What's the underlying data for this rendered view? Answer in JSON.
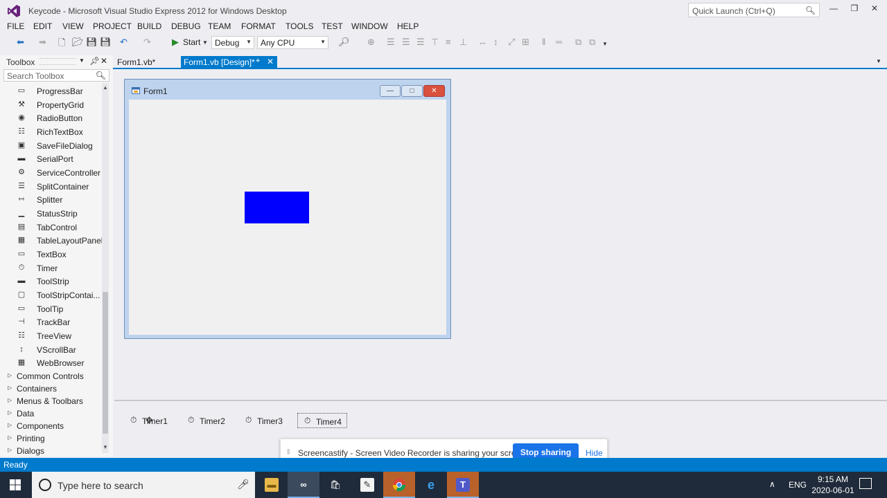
{
  "window": {
    "title": "Keycode - Microsoft Visual Studio Express 2012 for Windows Desktop",
    "quick_launch_placeholder": "Quick Launch (Ctrl+Q)"
  },
  "menu": [
    "FILE",
    "EDIT",
    "VIEW",
    "PROJECT",
    "BUILD",
    "DEBUG",
    "TEAM",
    "FORMAT",
    "TOOLS",
    "TEST",
    "WINDOW",
    "HELP"
  ],
  "toolbar": {
    "start_label": "Start",
    "config_value": "Debug",
    "platform_value": "Any CPU"
  },
  "toolbox": {
    "title": "Toolbox",
    "search_placeholder": "Search Toolbox",
    "items": [
      "ProgressBar",
      "PropertyGrid",
      "RadioButton",
      "RichTextBox",
      "SaveFileDialog",
      "SerialPort",
      "ServiceController",
      "SplitContainer",
      "Splitter",
      "StatusStrip",
      "TabControl",
      "TableLayoutPanel",
      "TextBox",
      "Timer",
      "ToolStrip",
      "ToolStripContai...",
      "ToolTip",
      "TrackBar",
      "TreeView",
      "VScrollBar",
      "WebBrowser"
    ],
    "groups": [
      "Common Controls",
      "Containers",
      "Menus & Toolbars",
      "Data",
      "Components",
      "Printing",
      "Dialogs"
    ]
  },
  "tabs": [
    {
      "label": "Form1.vb*",
      "active": false
    },
    {
      "label": "Form1.vb [Design]*",
      "active": true
    }
  ],
  "form": {
    "title": "Form1",
    "rect_color": "#0000ff"
  },
  "components": [
    "Timer1",
    "Timer2",
    "Timer3",
    "Timer4"
  ],
  "notification": {
    "text": "Screencastify - Screen Video Recorder is sharing your screen.",
    "stop_label": "Stop sharing",
    "hide_label": "Hide"
  },
  "status": {
    "text": "Ready"
  },
  "taskbar": {
    "search_placeholder": "Type here to search",
    "language": "ENG",
    "time": "9:15 AM",
    "date": "2020-06-01"
  },
  "colors": {
    "accent": "#007acc",
    "notify_button": "#1a73e8"
  }
}
